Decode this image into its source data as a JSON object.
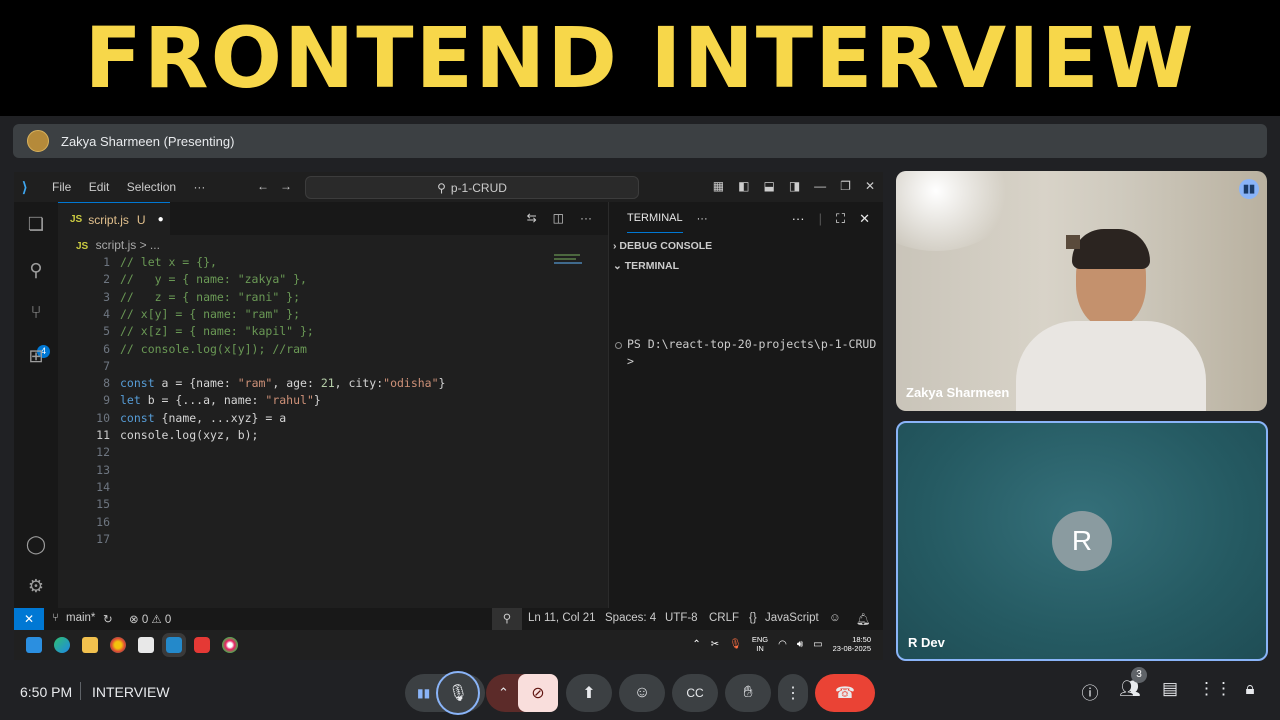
{
  "banner": {
    "title": "FRONTEND INTERVIEW"
  },
  "presenting": {
    "label": "Zakya Sharmeen (Presenting)"
  },
  "vscode": {
    "menu": [
      "File",
      "Edit",
      "Selection",
      "···"
    ],
    "search": "p-1-CRUD",
    "tab": {
      "lang": "JS",
      "name": "script.js",
      "status": "U"
    },
    "breadcrumb": {
      "lang": "JS",
      "path": "script.js > ..."
    },
    "source_control_badge": "4",
    "lines": [
      {
        "n": "1",
        "text": "// let x = {},"
      },
      {
        "n": "2",
        "text": "//   y = { name: \"zakya\" },"
      },
      {
        "n": "3",
        "text": "//   z = { name: \"rani\" };"
      },
      {
        "n": "4",
        "text": "// x[y] = { name: \"ram\" };"
      },
      {
        "n": "5",
        "text": "// x[z] = { name: \"kapil\" };"
      },
      {
        "n": "6",
        "text": "// console.log(x[y]); //ram"
      },
      {
        "n": "7",
        "text": ""
      },
      {
        "n": "8",
        "text": "const a = {name: \"ram\", age: 21, city:\"odisha\"}"
      },
      {
        "n": "9",
        "text": "let b = {...a, name: \"rahul\"}"
      },
      {
        "n": "10",
        "text": "const {name, ...xyz} = a"
      },
      {
        "n": "11",
        "text": "console.log(xyz, b);"
      },
      {
        "n": "12",
        "text": ""
      },
      {
        "n": "13",
        "text": ""
      },
      {
        "n": "14",
        "text": ""
      },
      {
        "n": "15",
        "text": ""
      },
      {
        "n": "16",
        "text": ""
      },
      {
        "n": "17",
        "text": ""
      }
    ],
    "panel": {
      "tab": "TERMINAL",
      "debug_console": "DEBUG CONSOLE",
      "terminal_section": "TERMINAL",
      "prompt": "PS D:\\react-top-20-projects\\p-1-CRUD>"
    },
    "status": {
      "branch": "main*",
      "problems": "⊗ 0 ⚠ 0",
      "position": "Ln 11, Col 21",
      "spaces": "Spaces: 4",
      "encoding": "UTF-8",
      "eol": "CRLF",
      "language": "JavaScript"
    }
  },
  "taskbar": {
    "lang": "ENG",
    "region": "IN",
    "time": "18:50",
    "date": "23-08-2025"
  },
  "participants": {
    "presenter": "Zakya Sharmeen",
    "other": {
      "name": "R Dev",
      "initial": "R"
    }
  },
  "meeting": {
    "time": "6:50 PM",
    "name": "INTERVIEW",
    "people_count": "3"
  },
  "colors": {
    "banner_text": "#f7d74a",
    "end_call": "#ea4335",
    "accent": "#8ab4f8"
  }
}
